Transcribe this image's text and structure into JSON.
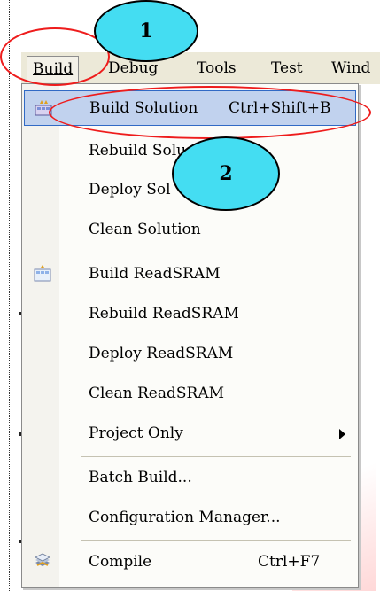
{
  "menubar": {
    "items": [
      {
        "label": "Build",
        "active": true
      },
      {
        "label": "Debug"
      },
      {
        "label": "Tools"
      },
      {
        "label": "Test"
      },
      {
        "label": "Wind"
      }
    ]
  },
  "menu": {
    "items": [
      {
        "label": "Build Solution",
        "shortcut": "Ctrl+Shift+B",
        "icon": "build-solution-icon",
        "highlight": true
      },
      {
        "label": "Rebuild Solu"
      },
      {
        "label": "Deploy Sol"
      },
      {
        "label": "Clean Solution"
      },
      {
        "label": "Build ReadSRAM",
        "icon": "build-project-icon"
      },
      {
        "label": "Rebuild ReadSRAM"
      },
      {
        "label": "Deploy ReadSRAM"
      },
      {
        "label": "Clean ReadSRAM"
      },
      {
        "label": "Project Only",
        "submenu": true
      },
      {
        "label": "Batch Build..."
      },
      {
        "label": "Configuration Manager..."
      },
      {
        "label": "Compile",
        "shortcut": "Ctrl+F7",
        "icon": "compile-icon"
      }
    ]
  },
  "annotations": {
    "callout_1": "1",
    "callout_2": "2",
    "callout_color": "#44ddf2",
    "oval_color": "#ee1c1c"
  }
}
